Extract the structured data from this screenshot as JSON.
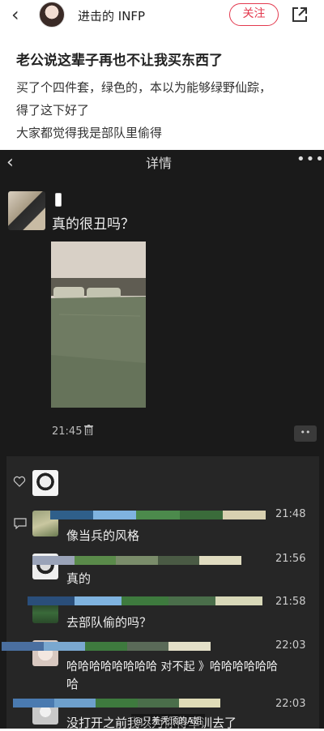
{
  "header": {
    "back_icon": "chevron-left-icon",
    "username": "进击的 INFP",
    "follow_label": "关注",
    "share_icon": "share-icon"
  },
  "post": {
    "title": "老公说这辈子再也不让我买东西了",
    "line1": "买了个四件套，绿色的，本以为能够绿野仙踪，",
    "line2": "得了这下好了",
    "line3": "大家都觉得我是部队里偷得"
  },
  "screenshot": {
    "nav_title": "详情",
    "nav_more": "•••",
    "question": "真的很丑吗？",
    "post_time": "21:45",
    "more_dots": "••",
    "comments": [
      {
        "time": "21:48",
        "text": "像当兵的风格"
      },
      {
        "time": "21:56",
        "text": "真的"
      },
      {
        "time": "21:58",
        "text": "去部队偷的吗？"
      },
      {
        "time": "22:03",
        "text_line1": "哈哈哈哈哈哈哈哈 对不起 》哈哈哈哈哈哈",
        "text_line2": "哈"
      },
      {
        "time": "22:03",
        "text": "没打开之前我以为你得军训去了"
      }
    ]
  },
  "watermark": "@只差秃顶的A姐"
}
